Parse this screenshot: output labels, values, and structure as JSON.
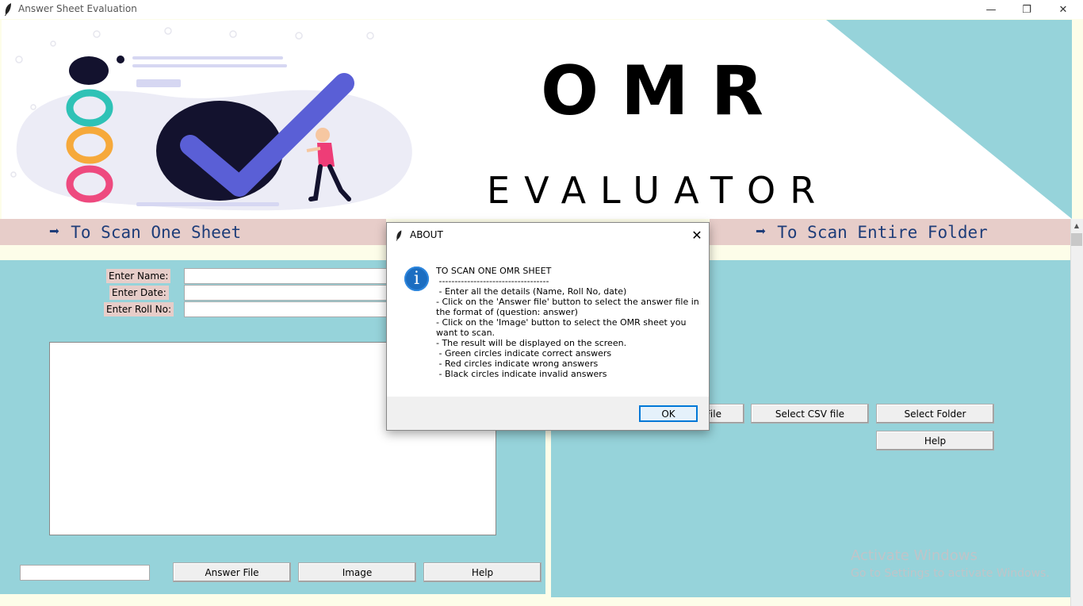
{
  "window": {
    "title": "Answer Sheet Evaluation",
    "controls": {
      "minimize": "—",
      "restore": "❐",
      "close": "✕"
    }
  },
  "banner": {
    "title": "OMR",
    "subtitle": "EVALUATOR",
    "colors": {
      "accent": "#96d3da",
      "check": "#5a5fd6",
      "dark": "#13122e"
    }
  },
  "left_section": {
    "header": "To Scan One Sheet",
    "labels": {
      "name": "Enter Name:",
      "date": "Enter Date:",
      "roll": "Enter Roll No:"
    },
    "inputs": {
      "name": "",
      "date": "",
      "roll": ""
    },
    "bottom_input": "",
    "buttons": {
      "answer_file": "Answer File",
      "image": "Image",
      "help": "Help"
    }
  },
  "right_section": {
    "header": "To Scan Entire Folder",
    "buttons": {
      "answer_file_partial": "File",
      "select_csv": "Select CSV file",
      "select_folder": "Select Folder",
      "help": "Help"
    }
  },
  "dialog": {
    "title": "ABOUT",
    "message": "TO SCAN ONE OMR SHEET\n -----------------------------------\n - Enter all the details (Name, Roll No, date)\n- Click on the 'Answer file' button to select the answer file in\nthe format of (question: answer)\n- Click on the 'Image' button to select the OMR sheet you\nwant to scan.\n- The result will be displayed on the screen.\n - Green circles indicate correct answers\n - Red circles indicate wrong answers\n - Black circles indicate invalid answers",
    "ok_label": "OK",
    "info_glyph": "i"
  },
  "watermark": {
    "line1": "Activate Windows",
    "line2": "Go to Settings to activate Windows."
  }
}
